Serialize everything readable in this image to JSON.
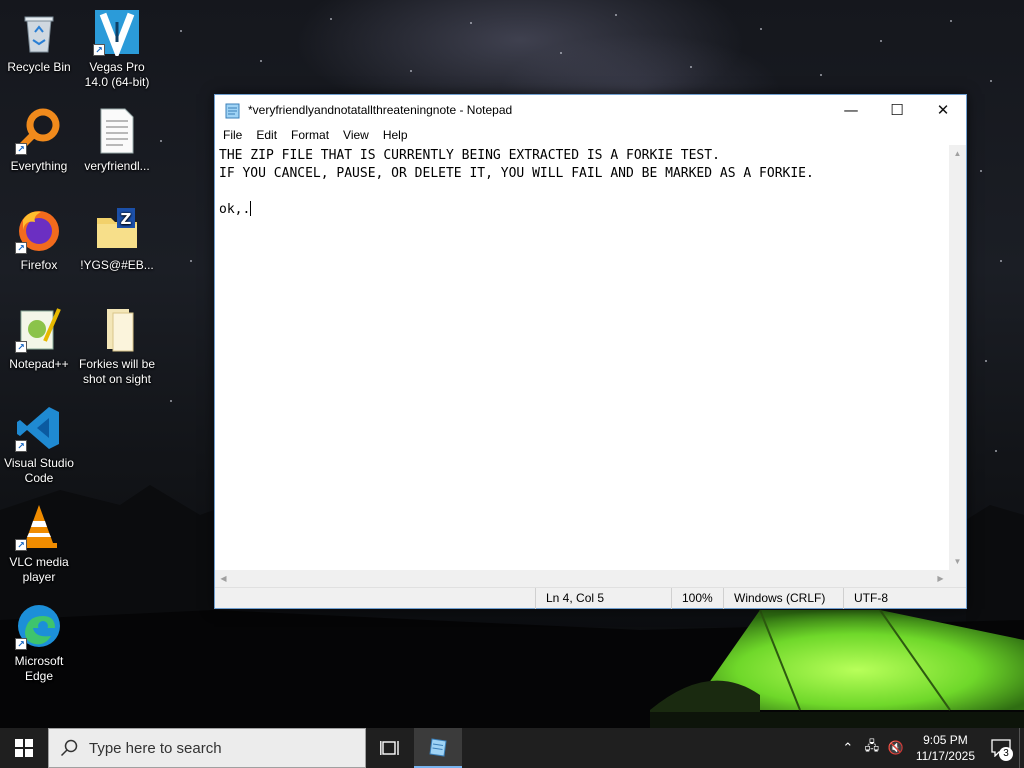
{
  "desktop": {
    "icons": [
      {
        "label": "Recycle Bin",
        "icon": "recycle-bin-icon"
      },
      {
        "label": "Vegas Pro 14.0 (64-bit)",
        "icon": "vegas-pro-icon"
      },
      {
        "label": "Everything",
        "icon": "everything-search-icon"
      },
      {
        "label": "veryfriendl...",
        "icon": "text-file-icon"
      },
      {
        "label": "Firefox",
        "icon": "firefox-icon"
      },
      {
        "label": "!YGS@#EB...",
        "icon": "zip-folder-icon"
      },
      {
        "label": "Notepad++",
        "icon": "notepad-plus-plus-icon"
      },
      {
        "label": "Forkies will be shot on sight",
        "icon": "folder-icon"
      },
      {
        "label": "Visual Studio Code",
        "icon": "vscode-icon"
      },
      {
        "label": "VLC media player",
        "icon": "vlc-icon"
      },
      {
        "label": "Microsoft Edge",
        "icon": "edge-icon"
      }
    ]
  },
  "notepad": {
    "title": "*veryfriendlyandnotatallthreateningnote - Notepad",
    "menu": [
      "File",
      "Edit",
      "Format",
      "View",
      "Help"
    ],
    "lines": [
      "THE ZIP FILE THAT IS CURRENTLY BEING EXTRACTED IS A FORKIE TEST.",
      "IF YOU CANCEL, PAUSE, OR DELETE IT, YOU WILL FAIL AND BE MARKED AS A FORKIE.",
      "",
      "ok,."
    ],
    "status": {
      "position": "Ln 4, Col 5",
      "zoom": "100%",
      "line_ending": "Windows (CRLF)",
      "encoding": "UTF-8"
    }
  },
  "taskbar": {
    "search_placeholder": "Type here to search",
    "time": "9:05 PM",
    "date": "11/17/2025",
    "notification_count": "3"
  }
}
